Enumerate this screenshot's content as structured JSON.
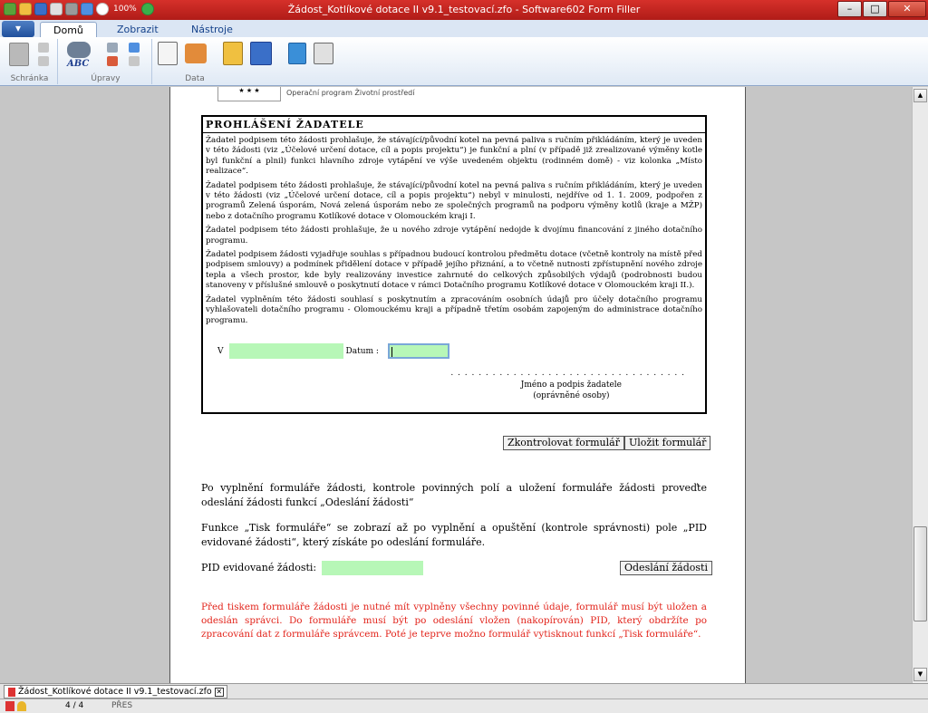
{
  "window": {
    "title": "Žádost_Kotlíkové dotace II v9.1_testovací.zfo - Software602 Form Filler",
    "zoom": "100%",
    "minimize": "–",
    "maximize": "□",
    "close": "✕"
  },
  "ribbon": {
    "app_button": "▾",
    "tabs": [
      {
        "label": "Domů"
      },
      {
        "label": "Zobrazit"
      },
      {
        "label": "Nástroje"
      }
    ],
    "groups": [
      {
        "label": "Schránka"
      },
      {
        "label": "Úpravy"
      },
      {
        "label": "Data"
      }
    ],
    "spell_label": "ABC"
  },
  "page": {
    "logo_stars": "★ ★ ★",
    "header_text": "Operační program Životní prostředí",
    "declaration": {
      "title": "PROHLÁŠENÍ ŽADATELE",
      "paragraphs": [
        "Žadatel podpisem této žádosti prohlašuje, že stávající/původní kotel na pevná paliva s ručním přikládáním, který je uveden v této žádosti (viz „Účelové určení dotace, cíl a popis projektu“) je funkční a plní (v případě již zrealizované výměny kotle byl funkční a plnil) funkci hlavního zdroje vytápění ve výše uvedeném objektu (rodinném domě) - viz kolonka „Místo realizace“.",
        "Žadatel podpisem této žádosti prohlašuje, že stávající/původní kotel na pevná paliva s ručním přikládáním, který je uveden v této žádosti (viz „Účelové určení dotace, cíl a popis projektu“) nebyl v minulosti, nejdříve od 1. 1. 2009, podpořen z programů Zelená úsporám, Nová zelená úsporám nebo ze společných programů na podporu výměny kotlů (kraje a MŽP) nebo z dotačního programu Kotlíkové dotace v Olomouckém kraji I.",
        "Žadatel podpisem této žádosti prohlašuje, že u nového zdroje vytápění nedojde k dvojímu financování z jiného dotačního programu.",
        "Žadatel podpisem žádosti vyjadřuje souhlas s případnou budoucí kontrolou předmětu dotace (včetně kontroly na místě před podpisem smlouvy) a podmínek přidělení dotace v případě jejího přiznání, a to včetně nutnosti zpřístupnění nového zdroje tepla a všech prostor, kde byly realizovány investice zahrnuté do celkových způsobilých výdajů (podrobnosti budou stanoveny v příslušné smlouvě o poskytnutí dotace v rámci Dotačního programu Kotlíkové dotace v Olomouckém kraji II.).",
        "Žadatel vyplněním této žádosti souhlasí s poskytnutím a zpracováním osobních údajů pro účely dotačního programu vyhlašovateli dotačního programu - Olomouckému kraji a případně třetím osobám zapojeným do administrace dotačního programu."
      ],
      "place_label": "V",
      "place_value": "",
      "date_label": "Datum :",
      "date_value": "",
      "signature_dots": ". . . . . . . . . . . . . . . . . . . . . . . . . . . . . . . . . .",
      "signature_line1": "Jméno a podpis žadatele",
      "signature_line2": "(oprávněné osoby)"
    },
    "buttons": {
      "check": "Zkontrolovat formulář",
      "save": "Uložit formulář",
      "send": "Odeslání žádosti"
    },
    "instruction1": "Po vyplnění formuláře žádosti, kontrole povinných polí a uložení formuláře žádosti proveďte odeslání žádosti funkcí „Odeslání žádosti“",
    "instruction2": "Funkce „Tisk formuláře“ se zobrazí až po vyplnění a opuštění (kontrole správnosti) pole „PID evidované žádosti“, který získáte po odeslání formuláře.",
    "pid_label": "PID evidované žádosti:",
    "pid_value": "",
    "warning": "Před tiskem formuláře žádosti je nutné mít vyplněny všechny povinné údaje, formulář musí být uložen a odeslán správci. Do formuláře musí být po odeslání vložen (nakopírován) PID, který obdržíte po zpracování dat z formuláře správcem. Poté je teprve možno formulář vytisknout funkcí „Tisk formuláře“.",
    "colors": {
      "field": "#b7f7b7",
      "warning": "#e2241b"
    }
  },
  "doc_tab": {
    "label": "Žádost_Kotlíkové dotace II v9.1_testovací.zfo",
    "close": "✕"
  },
  "status": {
    "page": "4 / 4",
    "mode": "PŘES"
  },
  "scroll": {
    "up": "▲",
    "down": "▼"
  }
}
